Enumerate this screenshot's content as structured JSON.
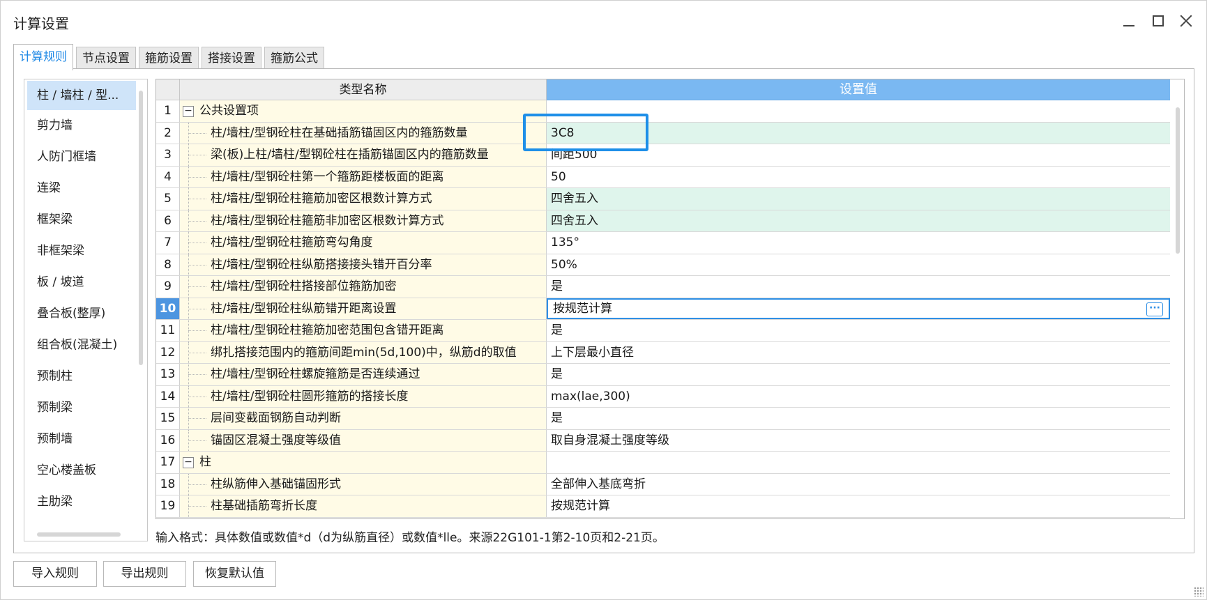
{
  "window": {
    "title": "计算设置"
  },
  "tabs": [
    "计算规则",
    "节点设置",
    "箍筋设置",
    "搭接设置",
    "箍筋公式"
  ],
  "sidebar": {
    "items": [
      "柱 / 墙柱 / 型...",
      "剪力墙",
      "人防门框墙",
      "连梁",
      "框架梁",
      "非框架梁",
      "板 / 坡道",
      "叠合板(整厚)",
      "组合板(混凝土)",
      "预制柱",
      "预制梁",
      "预制墙",
      "空心楼盖板",
      "主肋梁"
    ]
  },
  "grid": {
    "headers": {
      "name": "类型名称",
      "value": "设置值"
    },
    "rows": [
      {
        "num": "1",
        "name": "公共设置项",
        "value": "",
        "type": "group"
      },
      {
        "num": "2",
        "name": "柱/墙柱/型钢砼柱在基础插筋锚固区内的箍筋数量",
        "value": "3C8",
        "type": "green"
      },
      {
        "num": "3",
        "name": "梁(板)上柱/墙柱/型钢砼柱在插筋锚固区内的箍筋数量",
        "value": "间距500",
        "type": "plain"
      },
      {
        "num": "4",
        "name": "柱/墙柱/型钢砼柱第一个箍筋距楼板面的距离",
        "value": "50",
        "type": "plain"
      },
      {
        "num": "5",
        "name": "柱/墙柱/型钢砼柱箍筋加密区根数计算方式",
        "value": "四舍五入",
        "type": "green"
      },
      {
        "num": "6",
        "name": "柱/墙柱/型钢砼柱箍筋非加密区根数计算方式",
        "value": "四舍五入",
        "type": "green"
      },
      {
        "num": "7",
        "name": "柱/墙柱/型钢砼柱箍筋弯勾角度",
        "value": "135°",
        "type": "plain"
      },
      {
        "num": "8",
        "name": "柱/墙柱/型钢砼柱纵筋搭接接头错开百分率",
        "value": "50%",
        "type": "plain"
      },
      {
        "num": "9",
        "name": "柱/墙柱/型钢砼柱搭接部位箍筋加密",
        "value": "是",
        "type": "plain"
      },
      {
        "num": "10",
        "name": "柱/墙柱/型钢砼柱纵筋错开距离设置",
        "value": "按规范计算",
        "type": "selected"
      },
      {
        "num": "11",
        "name": "柱/墙柱/型钢砼柱箍筋加密范围包含错开距离",
        "value": "是",
        "type": "plain"
      },
      {
        "num": "12",
        "name": "绑扎搭接范围内的箍筋间距min(5d,100)中，纵筋d的取值",
        "value": "上下层最小直径",
        "type": "plain"
      },
      {
        "num": "13",
        "name": "柱/墙柱/型钢砼柱螺旋箍筋是否连续通过",
        "value": "是",
        "type": "plain"
      },
      {
        "num": "14",
        "name": "柱/墙柱/型钢砼柱圆形箍筋的搭接长度",
        "value": "max(lae,300)",
        "type": "plain"
      },
      {
        "num": "15",
        "name": "层间变截面钢筋自动判断",
        "value": "是",
        "type": "plain"
      },
      {
        "num": "16",
        "name": "锚固区混凝土强度等级值",
        "value": "取自身混凝土强度等级",
        "type": "plain"
      },
      {
        "num": "17",
        "name": "柱",
        "value": "",
        "type": "group"
      },
      {
        "num": "18",
        "name": "柱纵筋伸入基础锚固形式",
        "value": "全部伸入基底弯折",
        "type": "plain"
      },
      {
        "num": "19",
        "name": "柱基础插筋弯折长度",
        "value": "按规范计算",
        "type": "plain"
      }
    ]
  },
  "hint": "输入格式：具体数值或数值*d（d为纵筋直径）或数值*lle。来源22G101-1第2-10页和2-21页。",
  "buttons": {
    "import": "导入规则",
    "export": "导出规则",
    "reset": "恢复默认值"
  },
  "icons": {
    "minimize": "minimize-icon",
    "maximize": "maximize-icon",
    "close": "close-icon",
    "expander": "−",
    "ellipsis": "···"
  },
  "colors": {
    "accent": "#1e88e5",
    "header_value_bg": "#7ab8f2",
    "green_row": "#dff5ec",
    "name_col_bg": "#fffbe6"
  }
}
